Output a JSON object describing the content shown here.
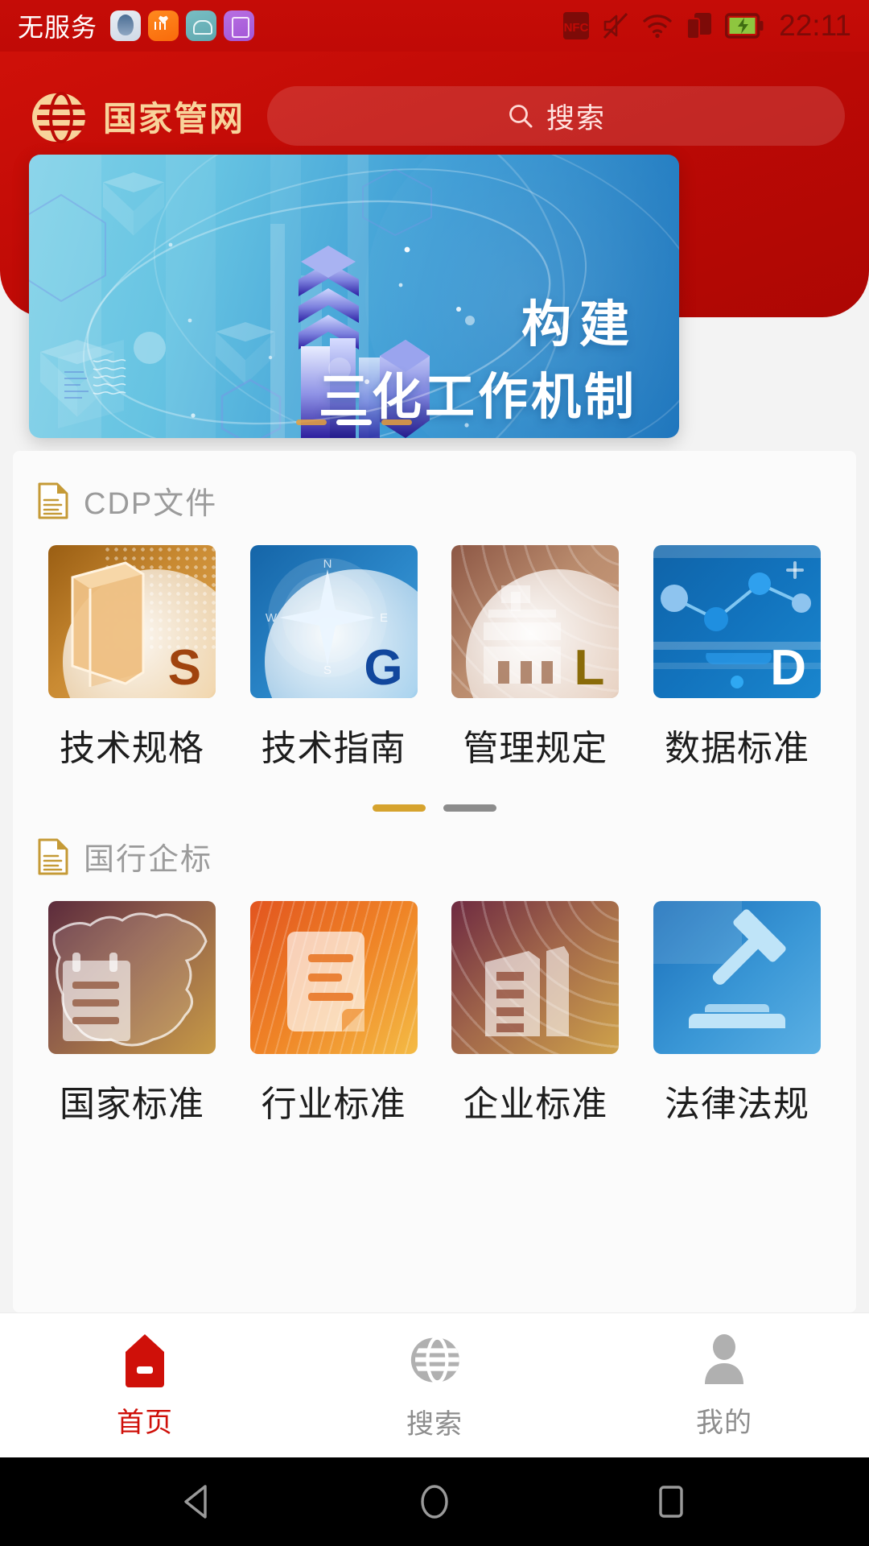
{
  "statusbar": {
    "carrier": "无服务",
    "time": "22:11",
    "app_icons": [
      "contact-app-icon",
      "health-app-icon",
      "android-app-icon",
      "gallery-app-icon"
    ],
    "system_icons": [
      "nfc-icon",
      "mute-icon",
      "wifi-icon",
      "dual-sim-icon",
      "battery-charging-icon"
    ],
    "nfc_label": "NFC"
  },
  "header": {
    "logo_icon": "national-pipeline-globe-logo",
    "brand": "国家管网",
    "search": {
      "icon": "search-icon",
      "placeholder": "搜索"
    }
  },
  "banner": {
    "title_line1": "构建",
    "title_line2": "三化工作机制",
    "dots": [
      {
        "active": false
      },
      {
        "active": true
      },
      {
        "active": false
      }
    ]
  },
  "sections": [
    {
      "id": "cdp",
      "icon": "document-icon",
      "title": "CDP文件",
      "tiles": [
        {
          "label": "技术规格",
          "badge": "S",
          "badge_color": "#a0430e",
          "art": "book-icon",
          "theme": "t-sg"
        },
        {
          "label": "技术指南",
          "badge": "G",
          "badge_color": "#11479d",
          "art": "compass-icon",
          "theme": "t-gg"
        },
        {
          "label": "管理规定",
          "badge": "L",
          "badge_color": "#8a6b09",
          "art": "courthouse-icon",
          "theme": "t-lg"
        },
        {
          "label": "数据标准",
          "badge": "D",
          "badge_color": "#ffffff",
          "art": "data-chart-icon",
          "theme": "t-dg"
        }
      ],
      "pager": [
        {
          "active": true
        },
        {
          "active": false
        }
      ]
    },
    {
      "id": "standards",
      "icon": "document-icon",
      "title": "国行企标",
      "tiles": [
        {
          "label": "国家标准",
          "badge": "",
          "badge_color": "",
          "art": "china-map-clipboard-icon",
          "theme": "t-map"
        },
        {
          "label": "行业标准",
          "badge": "",
          "badge_color": "",
          "art": "document-page-icon",
          "theme": "t-org"
        },
        {
          "label": "企业标准",
          "badge": "",
          "badge_color": "",
          "art": "office-buildings-icon",
          "theme": "t-ent"
        },
        {
          "label": "法律法规",
          "badge": "",
          "badge_color": "",
          "art": "gavel-icon",
          "theme": "t-law"
        }
      ],
      "pager": []
    }
  ],
  "tabbar": {
    "items": [
      {
        "label": "首页",
        "icon": "home-icon",
        "active": true
      },
      {
        "label": "搜索",
        "icon": "globe-search-icon",
        "active": false
      },
      {
        "label": "我的",
        "icon": "person-icon",
        "active": false
      }
    ]
  },
  "androidnav": {
    "buttons": [
      "back-triangle-icon",
      "home-circle-icon",
      "recents-square-icon"
    ]
  },
  "colors": {
    "brand_red": "#cf1009",
    "brand_gold": "#f8d39b",
    "accent_gold": "#d6a32e",
    "banner_blue": "#3b9ad4"
  }
}
